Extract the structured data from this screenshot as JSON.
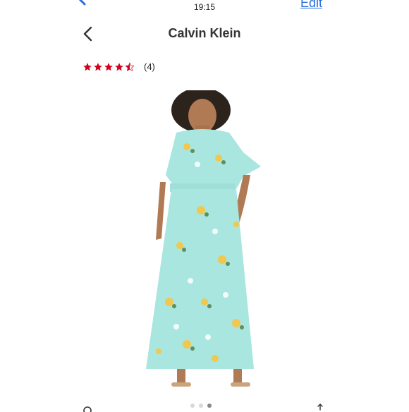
{
  "status_bar": {
    "time": "19:15"
  },
  "top": {
    "edit_label": "Edit",
    "back_icon": "chevron-left-icon"
  },
  "header": {
    "title": "Calvin Klein",
    "back_icon": "chevron-left-icon"
  },
  "rating": {
    "value": 4.5,
    "max": 5,
    "count_label": "(4)",
    "star_color": "#d0021b"
  },
  "product": {
    "image": "floral-maxi-dress-photo",
    "dress_color": "#a8e6df",
    "accent_color": "#f0c850"
  },
  "carousel": {
    "active_index": 2,
    "total": 3
  },
  "colors": {
    "link": "#2a6fe0",
    "title": "#333333"
  }
}
